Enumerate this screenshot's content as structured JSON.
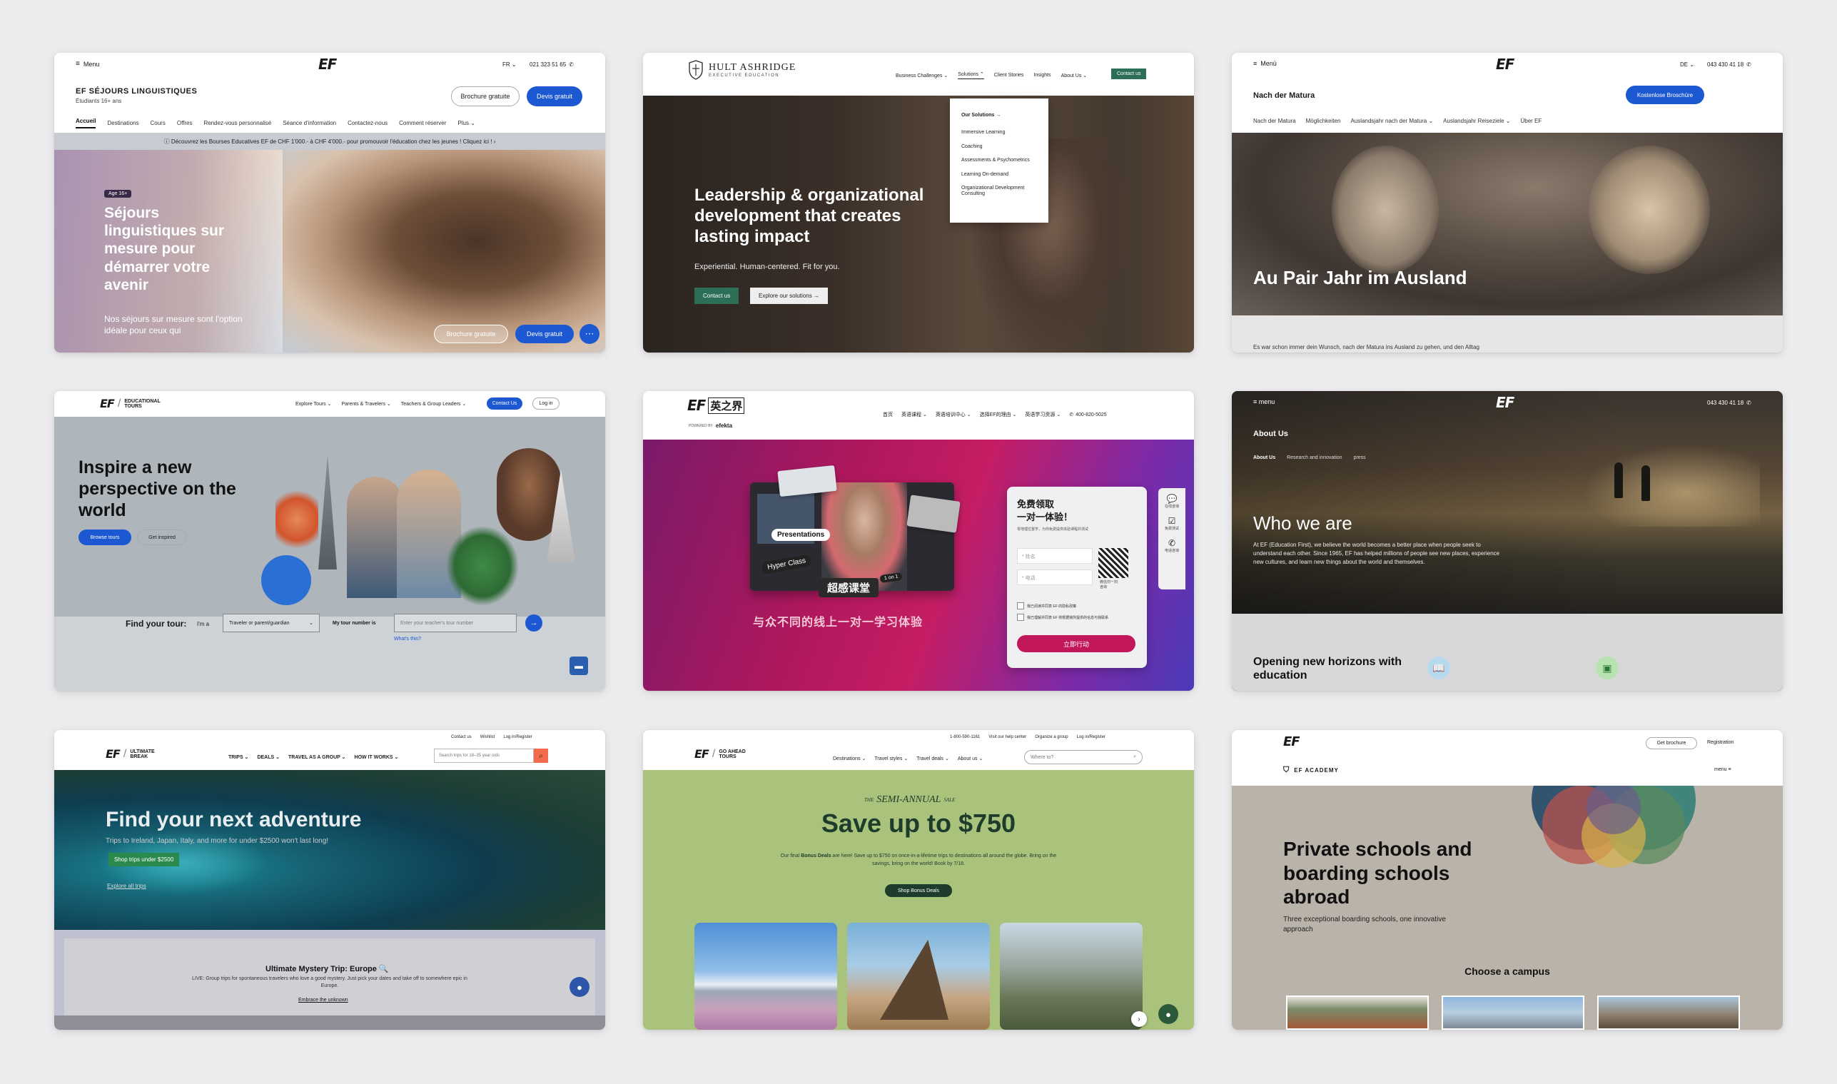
{
  "c1": {
    "menu": "Menu",
    "logo": "EF",
    "lang": "FR ⌄",
    "phone": "021 323 51 65",
    "brand": "EF SÉJOURS LINGUISTIQUES",
    "sub": "Étudiants 16+ ans",
    "btn_brochure": "Brochure gratuite",
    "btn_devis": "Devis gratuit",
    "nav": [
      "Accueil",
      "Destinations",
      "Cours",
      "Offres",
      "Rendez-vous personnalisé",
      "Séance d'information",
      "Contactez-nous",
      "Comment réserver",
      "Plus ⌄"
    ],
    "banner": "ⓘ  Découvrez les Bourses Educatives EF de CHF 1'000.- à CHF 4'000.- pour promouvoir l'éducation chez les jeunes ! Cliquez ici !  ›",
    "badge": "Age 16+",
    "title": "Séjours linguistiques sur mesure pour démarrer votre avenir",
    "desc": "Nos séjours sur mesure sont l'option idéale pour ceux qui",
    "b_brochure": "Brochure gratuite",
    "b_devis": "Devis gratuit"
  },
  "c2": {
    "logo_main": "HULT ASHRIDGE",
    "logo_sub": "EXECUTIVE EDUCATION",
    "nav": [
      "Business Challenges ⌄",
      "Solutions ⌃",
      "Client Stories",
      "Insights",
      "About Us ⌄"
    ],
    "contact": "Contact us",
    "dropdown": [
      "Our Solutions  →",
      "Immersive Learning",
      "Coaching",
      "Assessments & Psychometrics",
      "Learning On-demand",
      "Organizational Development Consulting"
    ],
    "title": "Leadership & organizational development that creates lasting impact",
    "tagline": "Experiential. Human-centered. Fit for you.",
    "btn_contact": "Contact us",
    "btn_explore": "Explore our solutions  →"
  },
  "c3": {
    "menu": "Menü",
    "logo": "EF",
    "lang": "DE ⌄",
    "phone": "043 430 41 18",
    "title_small": "Nach der Matura",
    "btn": "Kostenlose Broschüre",
    "nav": [
      "Nach der Matura",
      "Möglichkeiten",
      "Auslandsjahr nach der Matura ⌄",
      "Auslandsjahr Reiseziele ⌄",
      "Über EF"
    ],
    "hero": "Au Pair Jahr im Ausland",
    "foot": "Es war schon immer dein Wunsch, nach der Matura ins Ausland zu gehen, und den Alltag"
  },
  "c4": {
    "logo": "EF",
    "logo_text": "EDUCATIONAL TOURS",
    "nav": [
      "Explore Tours ⌄",
      "Parents & Travelers ⌄",
      "Teachers & Group Leaders ⌄"
    ],
    "contact": "Contact Us",
    "login": "Log in",
    "title": "Inspire a new perspective on the world",
    "b1": "Browse tours",
    "b2": "Get inspired",
    "find": "Find your tour:",
    "im_a": "I'm a",
    "select": "Traveler or parent/guardian",
    "tour_label": "My tour number is",
    "placeholder": "Enter your teacher's tour number",
    "whats": "What's this?"
  },
  "c5": {
    "logo": "EF",
    "logo_cn": "英之界",
    "powered": "POWERED BY",
    "powered_brand": "efekta",
    "nav": [
      "首页",
      "英语课程 ⌄",
      "英语培训中心 ⌄",
      "选择EF的理由 ⌄",
      "英语学习资源 ⌄"
    ],
    "phone": "400-820-5025",
    "presentations": "Presentations",
    "hyper": "Hyper Class",
    "oneone": "1 on 1",
    "chao": "超感课堂",
    "slogan": "与众不同的线上一对一学习体验",
    "form_title": "免费领取\n一对一体验！",
    "form_sub": "零地理位置学，为你免费提供体验课程并测试",
    "name_ph": "* 姓名",
    "phone_ph": "* 电话",
    "qr_text": "微信扫一扫\n咨询",
    "check1": "我已阅读并同意 EF 的隐私政策",
    "check2": "我已理解并同意 EF 将根据我所提供的信息与我联系",
    "submit": "立即行动",
    "side": [
      "在线咨询",
      "免费测试",
      "电话咨询"
    ]
  },
  "c6": {
    "menu": "≡  menu",
    "logo": "EF",
    "phone": "043 430 41 18",
    "section": "About Us",
    "subnav": [
      "About Us",
      "Research and innovation",
      "press"
    ],
    "title": "Who we are",
    "desc": "At EF (Education First), we believe the world becomes a better place when people seek to understand each other. Since 1965, EF has helped millions of people see new places, experience new cultures, and learn new things about the world and themselves.",
    "foot": "Opening new horizons with education"
  },
  "c7": {
    "top": [
      "Contact us",
      "Wishlist",
      "Log in/Register"
    ],
    "logo": "EF",
    "logo_text": "ULTIMATE BREAK",
    "nav": [
      "TRIPS ⌄",
      "DEALS ⌄",
      "TRAVEL AS A GROUP ⌄",
      "HOW IT WORKS ⌄"
    ],
    "search": "Search trips for 18–35 year olds",
    "title": "Find your next adventure",
    "desc": "Trips to Ireland, Japan, Italy, and more for under $2500 won't last long!",
    "btn": "Shop trips under $2500",
    "link": "Explore all trips",
    "card_title": "Ultimate Mystery Trip: Europe 🔍",
    "card_desc": "LIVE: Group trips for spontaneous travelers who love a good mystery. Just pick your dates and take off to somewhere epic in Europe.",
    "card_link": "Embrace the unknown"
  },
  "c8": {
    "top": [
      "1-800-590-1161",
      "Visit our help center",
      "Organize a group",
      "Log in/Register"
    ],
    "logo": "EF",
    "logo_text": "GO AHEAD TOURS",
    "nav": [
      "Destinations ⌄",
      "Travel styles ⌄",
      "Travel deals ⌄",
      "About us ⌄"
    ],
    "search": "Where to?",
    "kicker_the": "THE",
    "kicker": "SEMI-ANNUAL",
    "kicker_sale": "SALE",
    "title": "Save up to $750",
    "desc_pre": "Our final ",
    "desc_bold": "Bonus Deals",
    "desc_post": " are here! Save up to $750 on once-in-a-lifetime trips to destinations all around the globe. Bring on the savings, bring on the world! Book by 7/18.",
    "btn": "Shop Bonus Deals"
  },
  "c9": {
    "logo": "EF",
    "btn_brochure": "Get brochure",
    "register": "Registration",
    "academy": "EF ACADEMY",
    "menu": "menu  ≡",
    "title": "Private schools and boarding schools abroad",
    "desc": "Three exceptional boarding schools, one innovative approach",
    "choose": "Choose a campus"
  }
}
